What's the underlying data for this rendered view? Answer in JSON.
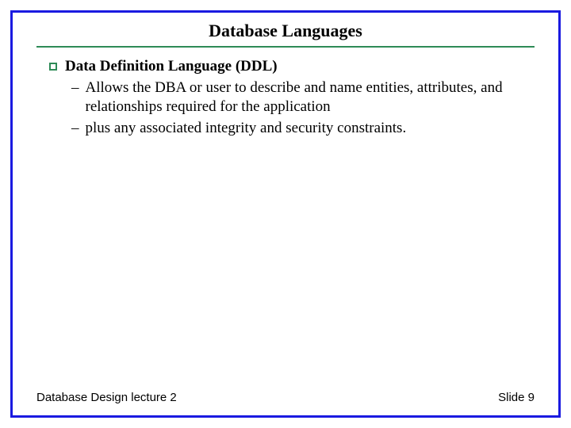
{
  "slide": {
    "title": "Database Languages",
    "bullet": {
      "label": "Data Definition Language (DDL)",
      "subitems": {
        "0": "Allows the DBA or user to describe and name entities, attributes, and relationships required for the application",
        "1": "plus any associated integrity and security constraints."
      }
    },
    "footer": {
      "left": "Database Design lecture 2",
      "right": "Slide 9"
    }
  }
}
